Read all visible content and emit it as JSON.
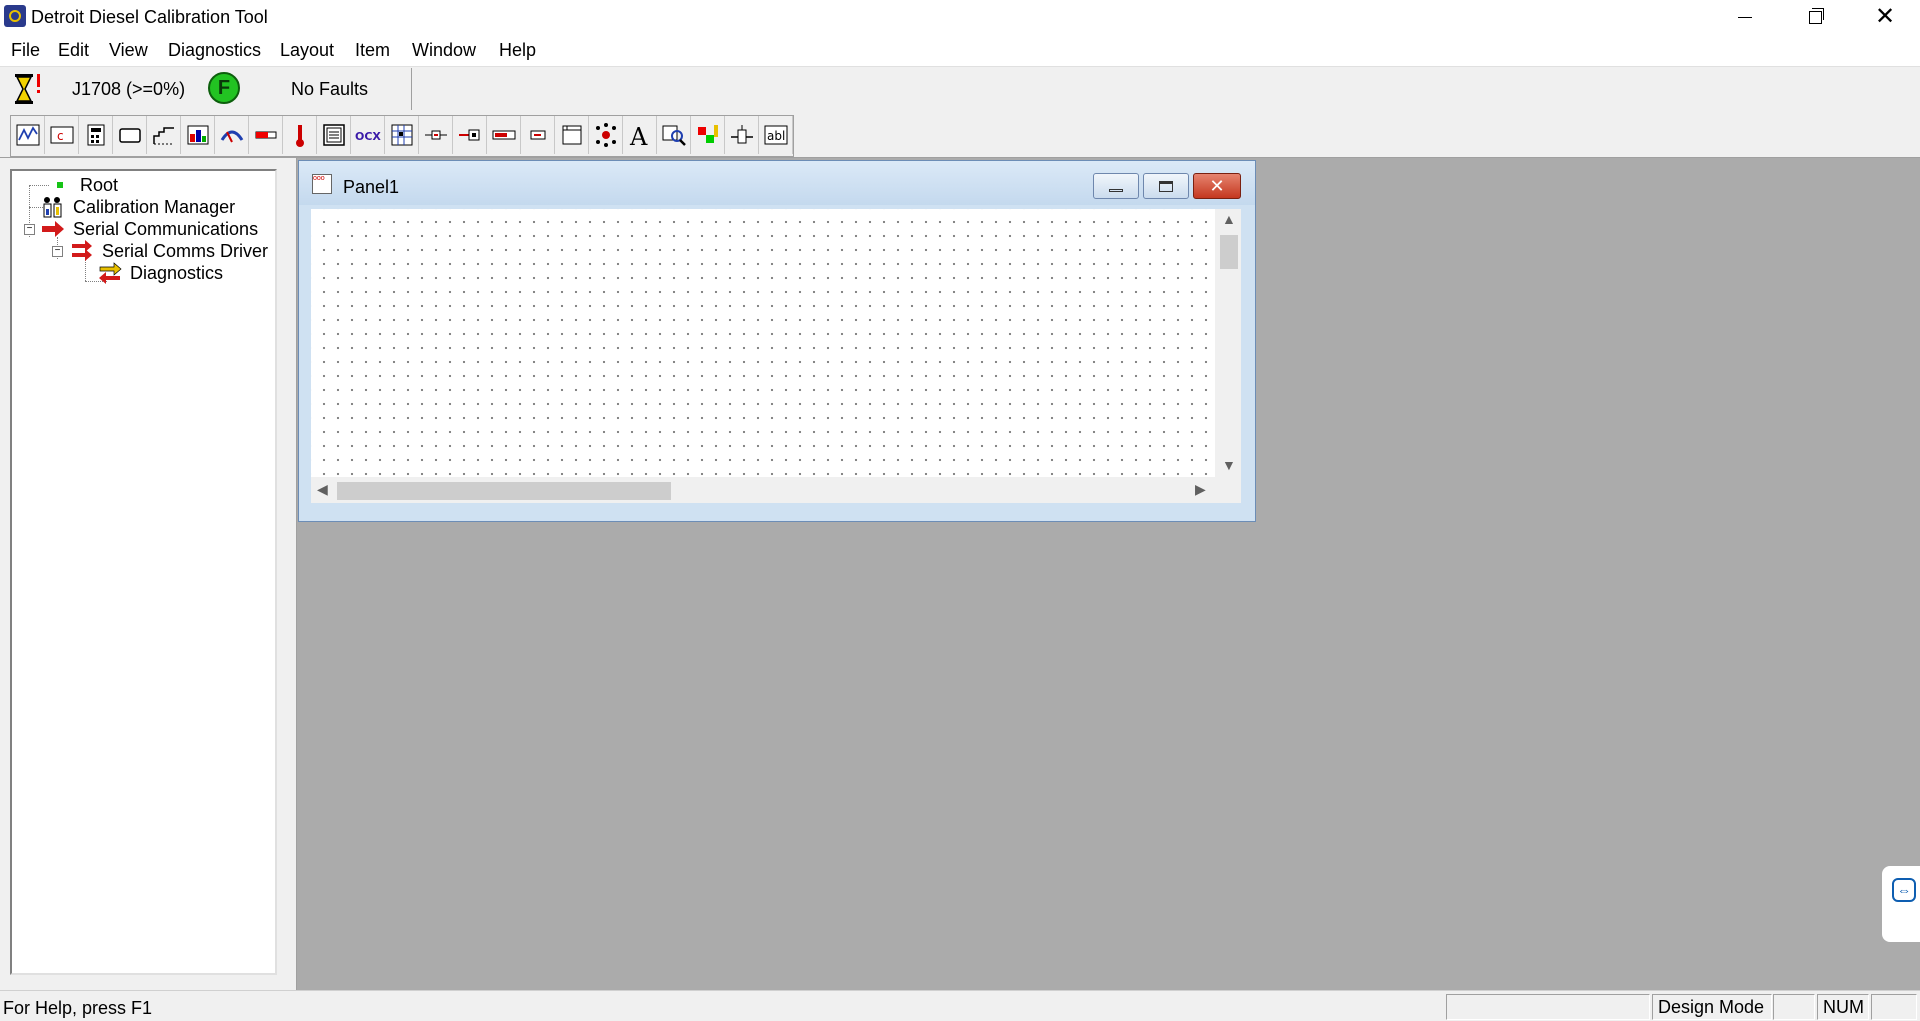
{
  "window": {
    "title": "Detroit Diesel Calibration Tool"
  },
  "menu": [
    "File",
    "Edit",
    "View",
    "Diagnostics",
    "Layout",
    "Item",
    "Window",
    "Help"
  ],
  "status_strip": {
    "protocol": "J1708 (>=0%)",
    "fault_indicator": "F",
    "faults": "No Faults"
  },
  "toolbar_icons": [
    "line-graph-icon",
    "clock-icon",
    "calculator-icon",
    "rectangle-icon",
    "table-icon",
    "chart-icon",
    "meter-icon",
    "bar-gauge-icon",
    "thermometer-icon",
    "list-box-icon",
    "ocx-icon",
    "grid-control-icon",
    "slider-h-icon",
    "slider-box-icon",
    "slider-bar-icon",
    "slider-small-icon",
    "panel-icon",
    "indicator-lights-icon",
    "text-icon",
    "zoom-icon",
    "led-icon",
    "valve-icon",
    "edit-box-icon"
  ],
  "tree": {
    "root": "Root",
    "calibration_manager": "Calibration Manager",
    "serial_communications": "Serial Communications",
    "serial_comms_driver": "Serial Comms Driver",
    "diagnostics": "Diagnostics"
  },
  "panel": {
    "title": "Panel1",
    "close_glyph": "✕"
  },
  "statusbar": {
    "help": "For Help, press F1",
    "mode": "Design Mode",
    "num": "NUM"
  },
  "colors": {
    "fault_green": "#22c322",
    "mdi_background": "#ababab",
    "close_red": "#c4371f",
    "serial_arrow_red": "#d21a1a"
  }
}
